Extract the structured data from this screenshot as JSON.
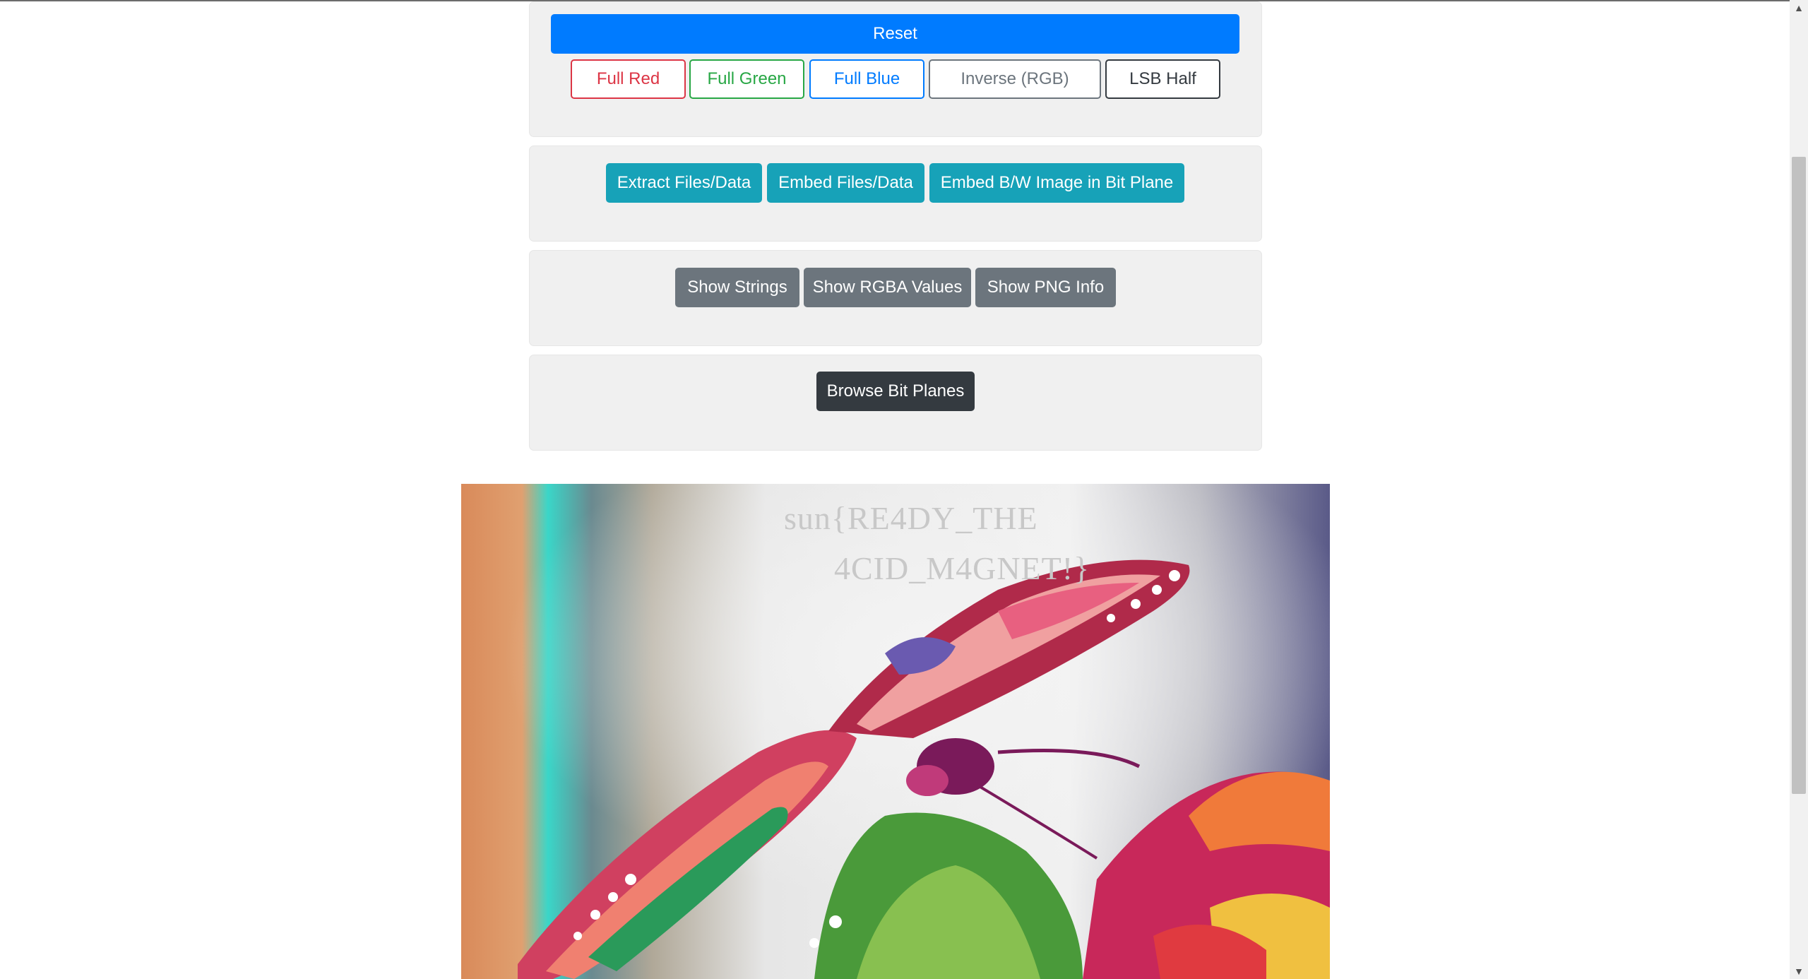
{
  "colors": {
    "primary": "#007bff",
    "danger": "#dc3545",
    "success": "#28a745",
    "info": "#17a2b8",
    "secondary": "#6c757d",
    "dark": "#343a40"
  },
  "color_panel": {
    "reset_label": "Reset",
    "buttons": [
      "Full Red",
      "Full Green",
      "Full Blue",
      "Inverse (RGB)",
      "LSB Half"
    ]
  },
  "data_panel": {
    "buttons": [
      "Extract Files/Data",
      "Embed Files/Data",
      "Embed B/W Image in Bit Plane"
    ]
  },
  "info_panel": {
    "buttons": [
      "Show Strings",
      "Show RGBA Values",
      "Show PNG Info"
    ]
  },
  "bitplane_panel": {
    "browse_label": "Browse Bit Planes"
  },
  "image": {
    "flag_line1": "sun{RE4DY_THE",
    "flag_line2": "4CID_M4GNET!}"
  }
}
